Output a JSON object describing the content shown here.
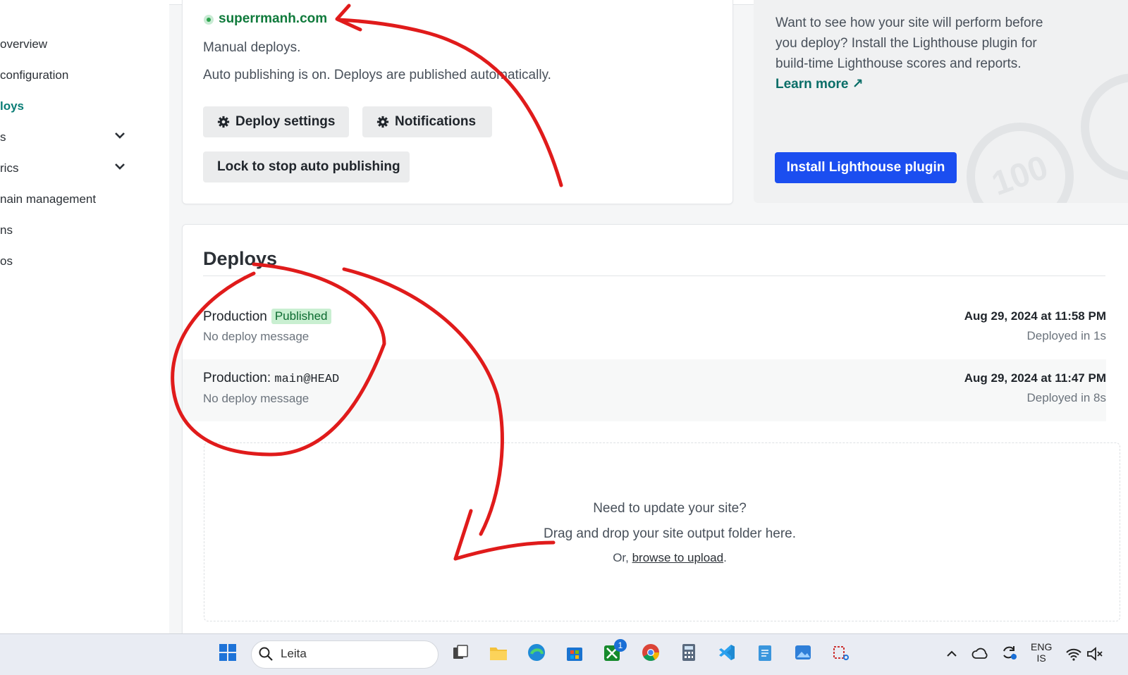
{
  "sidebar": {
    "items": [
      {
        "label": "overview"
      },
      {
        "label": "configuration"
      },
      {
        "label": "loys"
      },
      {
        "label": "s"
      },
      {
        "label": "rics"
      },
      {
        "label": "nain management"
      },
      {
        "label": "ns"
      },
      {
        "label": "os"
      }
    ]
  },
  "site_card": {
    "site_name": "superrmanh.com",
    "deploy_mode": "Manual deploys.",
    "publish_status": "Auto publishing is on. Deploys are published automatically.",
    "deploy_settings_label": "Deploy settings",
    "notifications_label": "Notifications",
    "lock_label": "Lock to stop auto publishing"
  },
  "lighthouse": {
    "text": "Want to see how your site will perform before you deploy? Install the Lighthouse plugin for build-time Lighthouse scores and reports.",
    "learn_more": "Learn more ↗",
    "button_label": "Install Lighthouse plugin",
    "score_graphic": "100"
  },
  "deploys": {
    "title": "Deploys",
    "rows": [
      {
        "title": "Production",
        "badge": "Published",
        "message": "No deploy message",
        "date": "Aug 29, 2024 at 11:58 PM",
        "duration": "Deployed in 1s"
      },
      {
        "title": "Production",
        "branch": "main@HEAD",
        "message": "No deploy message",
        "date": "Aug 29, 2024 at 11:47 PM",
        "duration": "Deployed in 8s"
      }
    ],
    "dropzone": {
      "line1": "Need to update your site?",
      "line2": "Drag and drop your site output folder here.",
      "line3_prefix": "Or, ",
      "line3_link": "browse to upload",
      "line3_suffix": "."
    }
  },
  "taskbar": {
    "search_placeholder": "Leita",
    "language": "ENG",
    "language_sub": "IS",
    "xbox_badge": "1",
    "icons": [
      "windows-start-icon",
      "search-icon",
      "task-view-icon",
      "file-explorer-icon",
      "edge-icon",
      "store-icon",
      "xbox-icon",
      "chrome-icon",
      "calculator-icon",
      "vscode-icon",
      "notepad-icon",
      "photos-icon",
      "snipping-tool-icon",
      "chevron-up-icon",
      "onedrive-icon",
      "sync-icon",
      "wifi-icon",
      "volume-muted-icon"
    ]
  },
  "colors": {
    "accent": "#0a7d76",
    "primary_button": "#1b4ef0",
    "annotation": "#e01b1b",
    "published_badge": "#c9efd1"
  }
}
